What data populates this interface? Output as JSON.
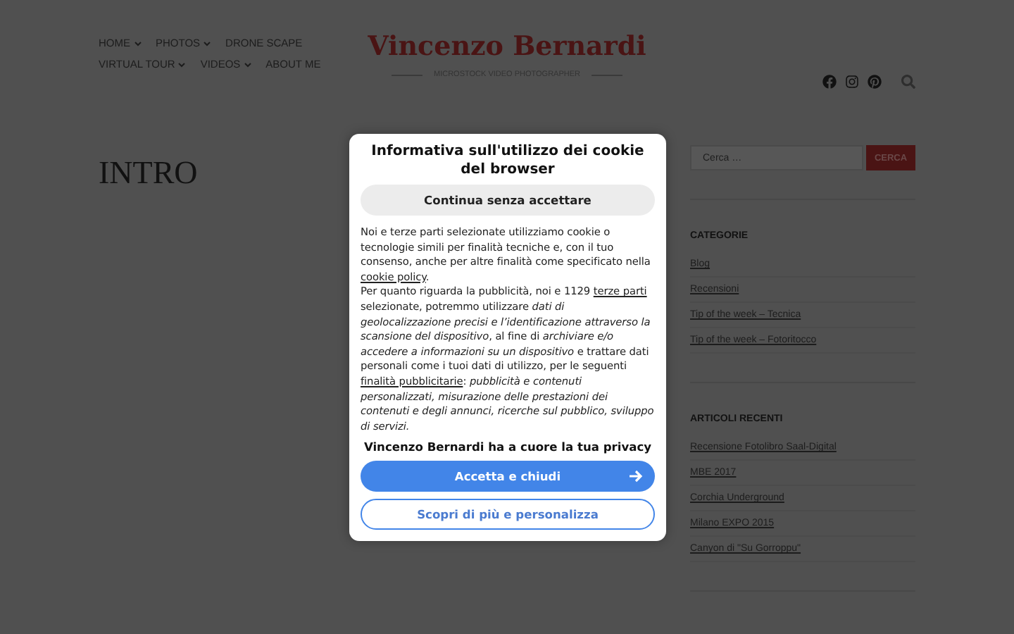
{
  "nav": {
    "rows": [
      [
        {
          "label": "HOME",
          "dropdown": true
        },
        {
          "label": "PHOTOS",
          "dropdown": true
        },
        {
          "label": "DRONE SCAPE",
          "dropdown": false
        }
      ],
      [
        {
          "label": "VIRTUAL TOUR",
          "dropdown": true
        },
        {
          "label": "VIDEOS",
          "dropdown": true
        },
        {
          "label": "ABOUT ME",
          "dropdown": false
        }
      ]
    ]
  },
  "site": {
    "title": "Vincenzo Bernardi",
    "tagline": "MICROSTOCK VIDEO PHOTOGRAPHER"
  },
  "social": [
    {
      "kind": "facebook"
    },
    {
      "kind": "instagram"
    },
    {
      "kind": "pinterest"
    },
    {
      "kind": "search"
    }
  ],
  "page": {
    "heading": "INTRO"
  },
  "sidebar": {
    "search": {
      "placeholder": "Cerca …",
      "button": "CERCA"
    },
    "sections": [
      {
        "title": "CATEGORIE",
        "items": [
          "Blog",
          "Recensioni",
          "Tip of the week – Tecnica",
          "Tip of the week – Fotoritocco"
        ]
      },
      {
        "title": "ARTICOLI RECENTI",
        "items": [
          "Recensione Fotolibro Saal-Digital",
          "MBE 2017",
          "Corchia Underground",
          "Milano EXPO 2015",
          "Canyon di \"Su Gorroppu\""
        ]
      }
    ]
  },
  "cookie_dialog": {
    "title": "Informativa sull'utilizzo dei cookie del browser",
    "skip_button": "Continua senza accettare",
    "paragraphs": [
      [
        {
          "kind": "plain",
          "text": "Noi e terze parti selezionate utilizziamo cookie o tecnologie simili per finalità tecniche e, con il tuo consenso, anche per altre finalità come specificato nella "
        },
        {
          "kind": "link",
          "text": "cookie policy"
        },
        {
          "kind": "plain",
          "text": "."
        }
      ],
      [
        {
          "kind": "plain",
          "text": "Per quanto riguarda la pubblicità, noi e 1129 "
        },
        {
          "kind": "link",
          "text": "terze parti"
        },
        {
          "kind": "plain",
          "text": " selezionate, potremmo utilizzare "
        },
        {
          "kind": "italic",
          "text": "dati di geolocalizzazione precisi e l’identificazione attraverso la scansione del dispositivo"
        },
        {
          "kind": "plain",
          "text": ", al fine di "
        },
        {
          "kind": "italic",
          "text": "archiviare e/o accedere a informazioni su un dispositivo"
        },
        {
          "kind": "plain",
          "text": " e trattare dati personali come i tuoi dati di utilizzo, per le seguenti "
        },
        {
          "kind": "link",
          "text": "finalità pubblicitarie"
        },
        {
          "kind": "plain",
          "text": ": "
        },
        {
          "kind": "italic",
          "text": "pubblicità e contenuti personalizzati, misurazione delle prestazioni dei contenuti e degli annunci, ricerche sul pubblico, sviluppo di servizi."
        }
      ]
    ],
    "privacy_note": "Vincenzo Bernardi ha a cuore la tua privacy",
    "accept_button": "Accetta e chiudi",
    "customize_button": "Scopri di più e personalizza"
  }
}
